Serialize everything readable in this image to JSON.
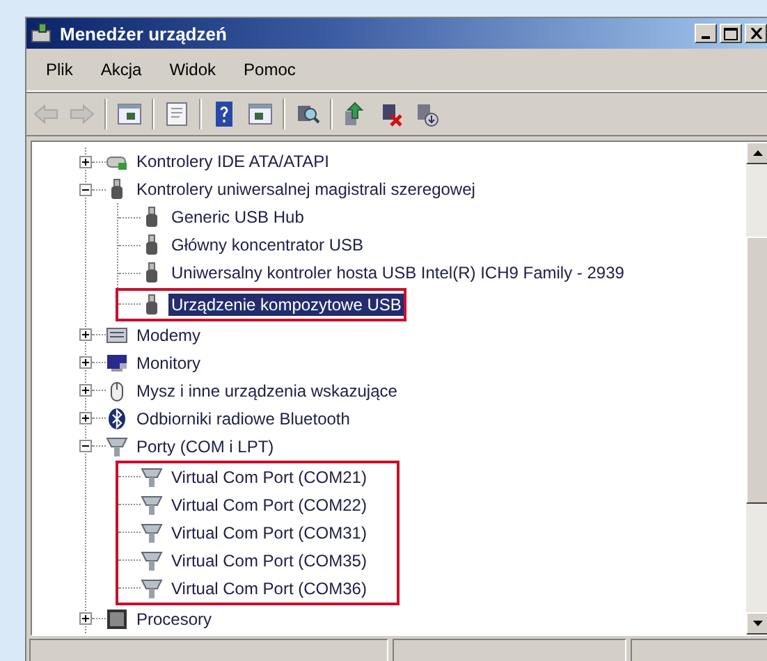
{
  "window": {
    "title": "Menedżer urządzeń"
  },
  "menu": [
    {
      "label": "Plik"
    },
    {
      "label": "Akcja"
    },
    {
      "label": "Widok"
    },
    {
      "label": "Pomoc"
    }
  ],
  "toolbar_groups": [
    {
      "items": [
        {
          "kind": "back",
          "disabled": true
        },
        {
          "kind": "forward",
          "disabled": true
        }
      ]
    },
    {
      "items": [
        {
          "kind": "tree",
          "disabled": false
        }
      ]
    },
    {
      "items": [
        {
          "kind": "properties",
          "disabled": false
        }
      ]
    },
    {
      "items": [
        {
          "kind": "help",
          "disabled": false
        },
        {
          "kind": "pane",
          "disabled": false
        }
      ]
    },
    {
      "items": [
        {
          "kind": "scan",
          "disabled": false
        }
      ]
    },
    {
      "items": [
        {
          "kind": "update",
          "disabled": false
        },
        {
          "kind": "uninstall",
          "disabled": false
        },
        {
          "kind": "disable",
          "disabled": false
        }
      ]
    }
  ],
  "tree": [
    {
      "label": "Kontrolery IDE ATA/ATAPI",
      "kind": "ide",
      "expanded": false,
      "selected": false
    },
    {
      "label": "Kontrolery uniwersalnej magistrali szeregowej",
      "kind": "usb",
      "expanded": true,
      "selected": false,
      "children_framed": false,
      "children": [
        {
          "label": "Generic USB Hub",
          "kind": "usb",
          "selected": false,
          "framed": false
        },
        {
          "label": "Główny koncentrator USB",
          "kind": "usb",
          "selected": false,
          "framed": false
        },
        {
          "label": "Uniwersalny kontroler hosta USB Intel(R) ICH9 Family - 2939",
          "kind": "usb",
          "selected": false,
          "framed": false
        },
        {
          "label": "Urządzenie kompozytowe USB",
          "kind": "usb",
          "selected": true,
          "framed": true
        }
      ]
    },
    {
      "label": "Modemy",
      "kind": "modem",
      "expanded": false,
      "selected": false
    },
    {
      "label": "Monitory",
      "kind": "monitor",
      "expanded": false,
      "selected": false
    },
    {
      "label": "Mysz i inne urządzenia wskazujące",
      "kind": "mouse",
      "expanded": false,
      "selected": false
    },
    {
      "label": "Odbiorniki radiowe Bluetooth",
      "kind": "bluetooth",
      "expanded": false,
      "selected": false
    },
    {
      "label": "Porty (COM i LPT)",
      "kind": "port",
      "expanded": true,
      "selected": false,
      "children_framed": true,
      "children": [
        {
          "label": "Virtual Com Port (COM21)",
          "kind": "port",
          "selected": false,
          "framed": false
        },
        {
          "label": "Virtual Com Port (COM22)",
          "kind": "port",
          "selected": false,
          "framed": false
        },
        {
          "label": "Virtual Com Port (COM31)",
          "kind": "port",
          "selected": false,
          "framed": false
        },
        {
          "label": "Virtual Com Port (COM35)",
          "kind": "port",
          "selected": false,
          "framed": false
        },
        {
          "label": "Virtual Com Port (COM36)",
          "kind": "port",
          "selected": false,
          "framed": false
        }
      ]
    },
    {
      "label": "Procesory",
      "kind": "cpu",
      "expanded": false,
      "selected": false
    }
  ]
}
